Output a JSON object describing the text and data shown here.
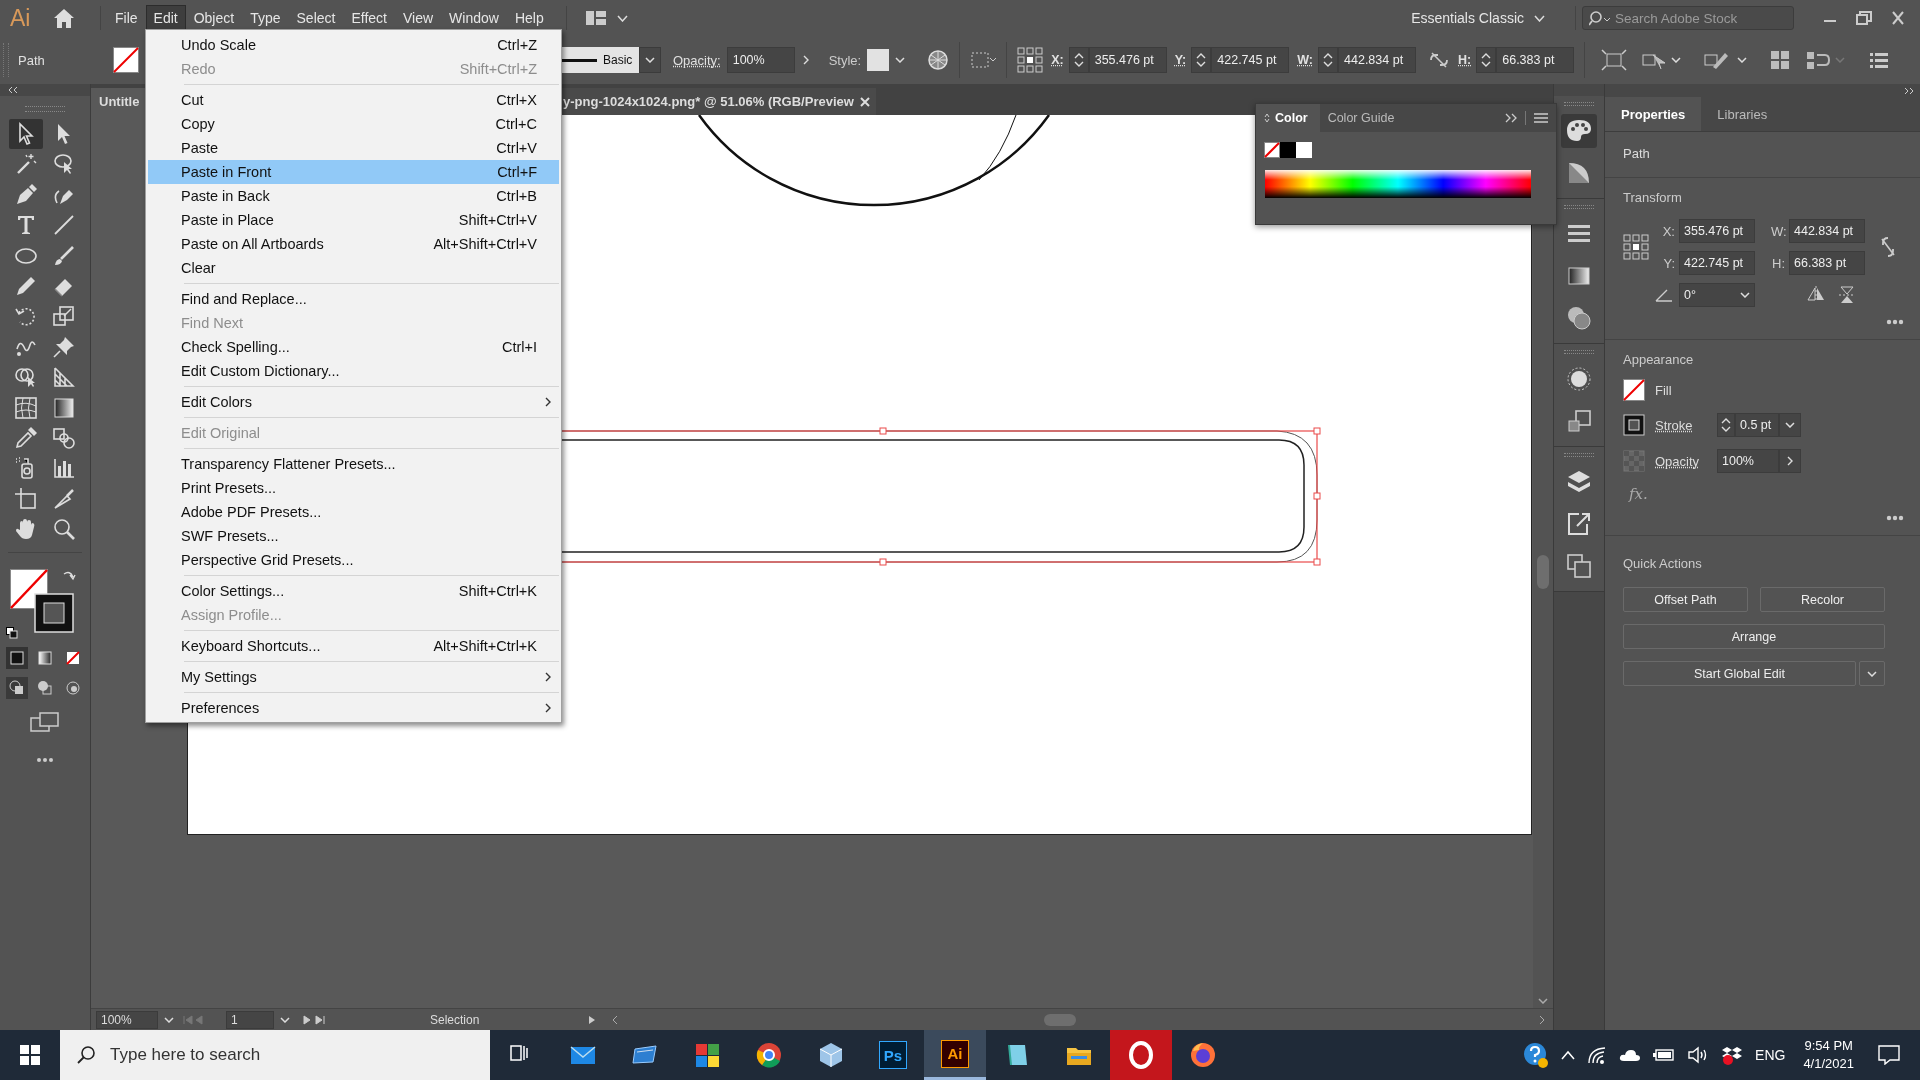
{
  "app_logo": "Ai",
  "menubar": {
    "items": [
      {
        "label": "File",
        "selected": false
      },
      {
        "label": "Edit",
        "selected": true
      },
      {
        "label": "Object",
        "selected": false
      },
      {
        "label": "Type",
        "selected": false
      },
      {
        "label": "Select",
        "selected": false
      },
      {
        "label": "Effect",
        "selected": false
      },
      {
        "label": "View",
        "selected": false
      },
      {
        "label": "Window",
        "selected": false
      },
      {
        "label": "Help",
        "selected": false
      }
    ],
    "workspace": "Essentials Classic",
    "stock_search": {
      "placeholder": "Search Adobe Stock"
    }
  },
  "control_bar": {
    "selection": "Path",
    "stroke_profile": "Basic",
    "opacity_label": "Opacity:",
    "opacity": "100%",
    "style_label": "Style:",
    "fields": [
      {
        "label": "X:",
        "value": "355.476 pt"
      },
      {
        "label": "Y:",
        "value": "422.745 pt"
      },
      {
        "label": "W:",
        "value": "442.834 pt"
      },
      {
        "label": "H:",
        "value": "66.383 pt"
      }
    ]
  },
  "tools": [
    {
      "kind": "selection",
      "selected": true
    },
    {
      "kind": "direct-selection",
      "selected": false
    },
    {
      "kind": "magic-wand",
      "selected": false
    },
    {
      "kind": "lasso",
      "selected": false
    },
    {
      "kind": "pen",
      "selected": false
    },
    {
      "kind": "curvature",
      "selected": false
    },
    {
      "kind": "type",
      "selected": false
    },
    {
      "kind": "line",
      "selected": false
    },
    {
      "kind": "ellipse",
      "selected": false
    },
    {
      "kind": "brush",
      "selected": false
    },
    {
      "kind": "pencil",
      "selected": false
    },
    {
      "kind": "eraser",
      "selected": false
    },
    {
      "kind": "rotate",
      "selected": false
    },
    {
      "kind": "scale",
      "selected": false
    },
    {
      "kind": "warp",
      "selected": false
    },
    {
      "kind": "pin",
      "selected": false
    },
    {
      "kind": "shape-builder",
      "selected": false
    },
    {
      "kind": "perspective",
      "selected": false
    },
    {
      "kind": "mesh",
      "selected": false
    },
    {
      "kind": "gradient",
      "selected": false
    },
    {
      "kind": "eyedropper",
      "selected": false
    },
    {
      "kind": "blend",
      "selected": false
    },
    {
      "kind": "sprayer",
      "selected": false
    },
    {
      "kind": "graph",
      "selected": false
    },
    {
      "kind": "artboard",
      "selected": false
    },
    {
      "kind": "slice",
      "selected": false
    },
    {
      "kind": "hand",
      "selected": false
    },
    {
      "kind": "zoom",
      "selected": false
    }
  ],
  "document_tabs": [
    {
      "title": "Untitle",
      "selected": false
    },
    {
      "title": "y-png-1024x1024.png* @ 51.06% (RGB/Preview",
      "selected": true
    }
  ],
  "status_bar": {
    "zoom": "100%",
    "artboard": "1",
    "tool": "Selection"
  },
  "color_panel": {
    "tabs": [
      {
        "label": "Color",
        "selected": true
      },
      {
        "label": "Color Guide",
        "selected": false
      }
    ]
  },
  "panel_dock": [
    {
      "kind": "color",
      "selected": true
    },
    {
      "kind": "color-guide",
      "selected": false
    },
    {
      "kind": "stroke",
      "selected": false
    },
    {
      "kind": "gradient",
      "selected": false
    },
    {
      "kind": "transparency",
      "selected": false
    },
    {
      "kind": "appearance",
      "selected": false
    },
    {
      "kind": "graphic-styles",
      "selected": false
    },
    {
      "kind": "layers",
      "selected": false
    },
    {
      "kind": "export",
      "selected": false
    },
    {
      "kind": "artboards",
      "selected": false
    }
  ],
  "properties": {
    "tabs": [
      {
        "label": "Properties",
        "selected": true
      },
      {
        "label": "Libraries",
        "selected": false
      }
    ],
    "object_type": "Path",
    "transform": {
      "title": "Transform",
      "fields": [
        {
          "label": "X:",
          "value": "355.476 pt"
        },
        {
          "label": "W:",
          "value": "442.834 pt"
        },
        {
          "label": "Y:",
          "value": "422.745 pt"
        },
        {
          "label": "H:",
          "value": "66.383 pt"
        }
      ],
      "angle": "0°"
    },
    "appearance": {
      "title": "Appearance",
      "fill_label": "Fill",
      "stroke_label": "Stroke",
      "stroke_weight": "0.5 pt",
      "opacity_label": "Opacity",
      "opacity": "100%",
      "fx": "fx."
    },
    "quick_actions": {
      "title": "Quick Actions",
      "buttons": [
        "Offset Path",
        "Recolor",
        "Arrange",
        "Start Global Edit"
      ]
    }
  },
  "edit_menu": {
    "groups": [
      [
        {
          "label": "Undo Scale",
          "shortcut": "Ctrl+Z",
          "disabled": false,
          "selected": false,
          "submenu": false
        },
        {
          "label": "Redo",
          "shortcut": "Shift+Ctrl+Z",
          "disabled": true,
          "selected": false,
          "submenu": false
        }
      ],
      [
        {
          "label": "Cut",
          "shortcut": "Ctrl+X",
          "disabled": false,
          "selected": false,
          "submenu": false
        },
        {
          "label": "Copy",
          "shortcut": "Ctrl+C",
          "disabled": false,
          "selected": false,
          "submenu": false
        },
        {
          "label": "Paste",
          "shortcut": "Ctrl+V",
          "disabled": false,
          "selected": false,
          "submenu": false
        },
        {
          "label": "Paste in Front",
          "shortcut": "Ctrl+F",
          "disabled": false,
          "selected": true,
          "submenu": false
        },
        {
          "label": "Paste in Back",
          "shortcut": "Ctrl+B",
          "disabled": false,
          "selected": false,
          "submenu": false
        },
        {
          "label": "Paste in Place",
          "shortcut": "Shift+Ctrl+V",
          "disabled": false,
          "selected": false,
          "submenu": false
        },
        {
          "label": "Paste on All Artboards",
          "shortcut": "Alt+Shift+Ctrl+V",
          "disabled": false,
          "selected": false,
          "submenu": false
        },
        {
          "label": "Clear",
          "disabled": false,
          "selected": false,
          "submenu": false
        }
      ],
      [
        {
          "label": "Find and Replace...",
          "disabled": false,
          "selected": false,
          "submenu": false
        },
        {
          "label": "Find Next",
          "disabled": true,
          "selected": false,
          "submenu": false
        },
        {
          "label": "Check Spelling...",
          "shortcut": "Ctrl+I",
          "disabled": false,
          "selected": false,
          "submenu": false
        },
        {
          "label": "Edit Custom Dictionary...",
          "disabled": false,
          "selected": false,
          "submenu": false
        }
      ],
      [
        {
          "label": "Edit Colors",
          "disabled": false,
          "selected": false,
          "submenu": true
        }
      ],
      [
        {
          "label": "Edit Original",
          "disabled": true,
          "selected": false,
          "submenu": false
        }
      ],
      [
        {
          "label": "Transparency Flattener Presets...",
          "disabled": false,
          "selected": false,
          "submenu": false
        },
        {
          "label": "Print Presets...",
          "disabled": false,
          "selected": false,
          "submenu": false
        },
        {
          "label": "Adobe PDF Presets...",
          "disabled": false,
          "selected": false,
          "submenu": false
        },
        {
          "label": "SWF Presets...",
          "disabled": false,
          "selected": false,
          "submenu": false
        },
        {
          "label": "Perspective Grid Presets...",
          "disabled": false,
          "selected": false,
          "submenu": false
        }
      ],
      [
        {
          "label": "Color Settings...",
          "shortcut": "Shift+Ctrl+K",
          "disabled": false,
          "selected": false,
          "submenu": false
        },
        {
          "label": "Assign Profile...",
          "disabled": true,
          "selected": false,
          "submenu": false
        }
      ],
      [
        {
          "label": "Keyboard Shortcuts...",
          "shortcut": "Alt+Shift+Ctrl+K",
          "disabled": false,
          "selected": false,
          "submenu": false
        }
      ],
      [
        {
          "label": "My Settings",
          "disabled": false,
          "selected": false,
          "submenu": true
        }
      ],
      [
        {
          "label": "Preferences",
          "disabled": false,
          "selected": false,
          "submenu": true
        }
      ]
    ]
  },
  "taskbar": {
    "search": {
      "placeholder": "Type here to search"
    },
    "apps": [
      {
        "kind": "task-view",
        "selected": false
      },
      {
        "kind": "mail",
        "selected": false
      },
      {
        "kind": "window",
        "selected": false
      },
      {
        "kind": "tiles",
        "selected": false
      },
      {
        "kind": "chrome",
        "selected": false
      },
      {
        "kind": "cube",
        "selected": false
      },
      {
        "kind": "photoshop",
        "label": "Ps",
        "selected": false
      },
      {
        "kind": "illustrator",
        "label": "Ai",
        "selected": true
      },
      {
        "kind": "notebook",
        "selected": false
      },
      {
        "kind": "folder",
        "selected": false
      },
      {
        "kind": "opera",
        "selected": false
      },
      {
        "kind": "firefox",
        "selected": false
      }
    ],
    "language": "ENG",
    "time": "9:54 PM",
    "date": "4/1/2021"
  }
}
